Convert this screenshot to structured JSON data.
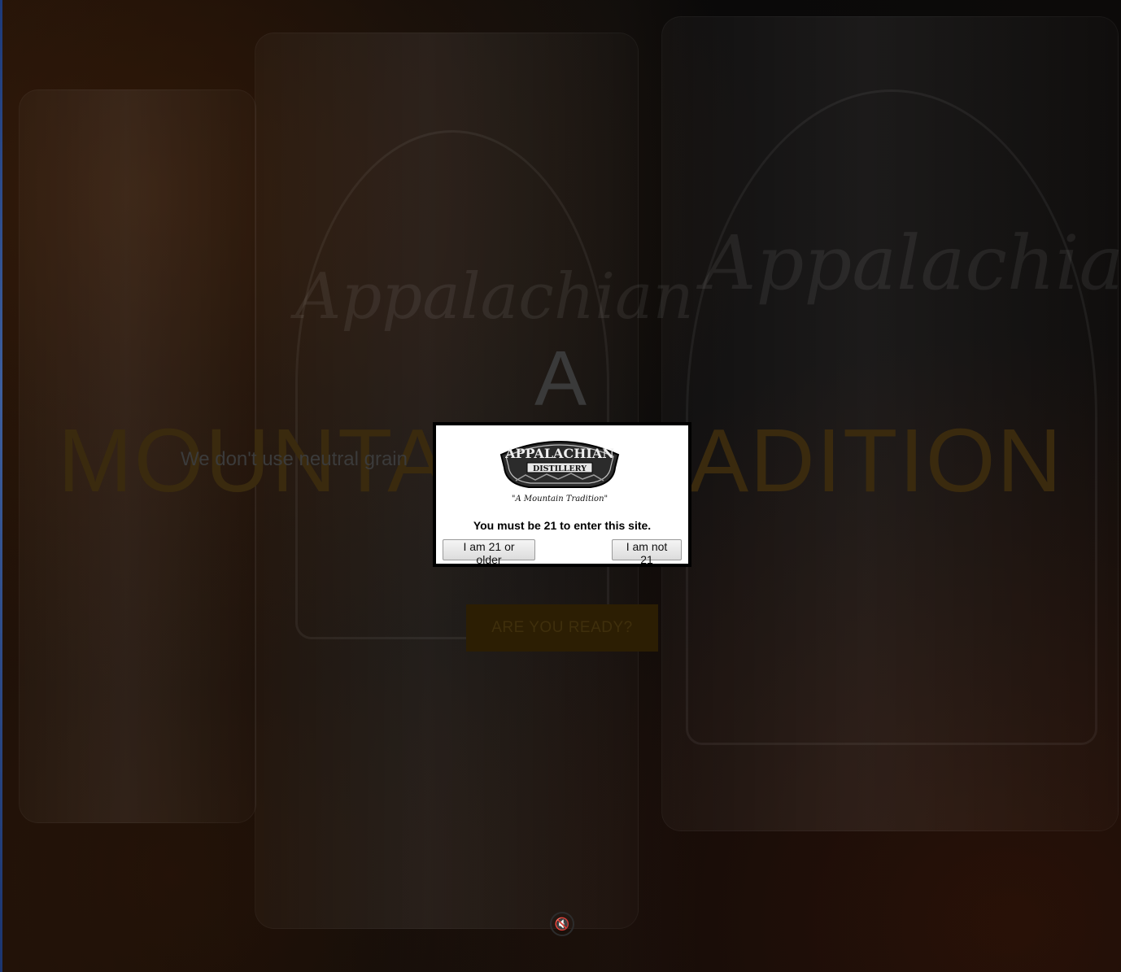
{
  "hero": {
    "letter": "A",
    "line": "MOUNTAIN TRADITION",
    "subtitle": "We don't use neutral grain",
    "cta": "ARE YOU READY?",
    "mute_icon": "speaker-mute-icon"
  },
  "background": {
    "script_left": "Appalachian",
    "script_right": "Appalachian"
  },
  "age_gate": {
    "logo": {
      "top_word": "APPALACHIAN",
      "bottom_word": "DISTILLERY",
      "tagline": "\"A Mountain Tradition\""
    },
    "message": "You must be 21 to enter this site.",
    "confirm_label": "I am 21 or older",
    "deny_label": "I am not 21"
  },
  "colors": {
    "overlay": "#0b0b0b",
    "hero_gold": "#3a2a0e",
    "cta_bg": "#2c1e03",
    "modal_bg": "#ffffff"
  }
}
